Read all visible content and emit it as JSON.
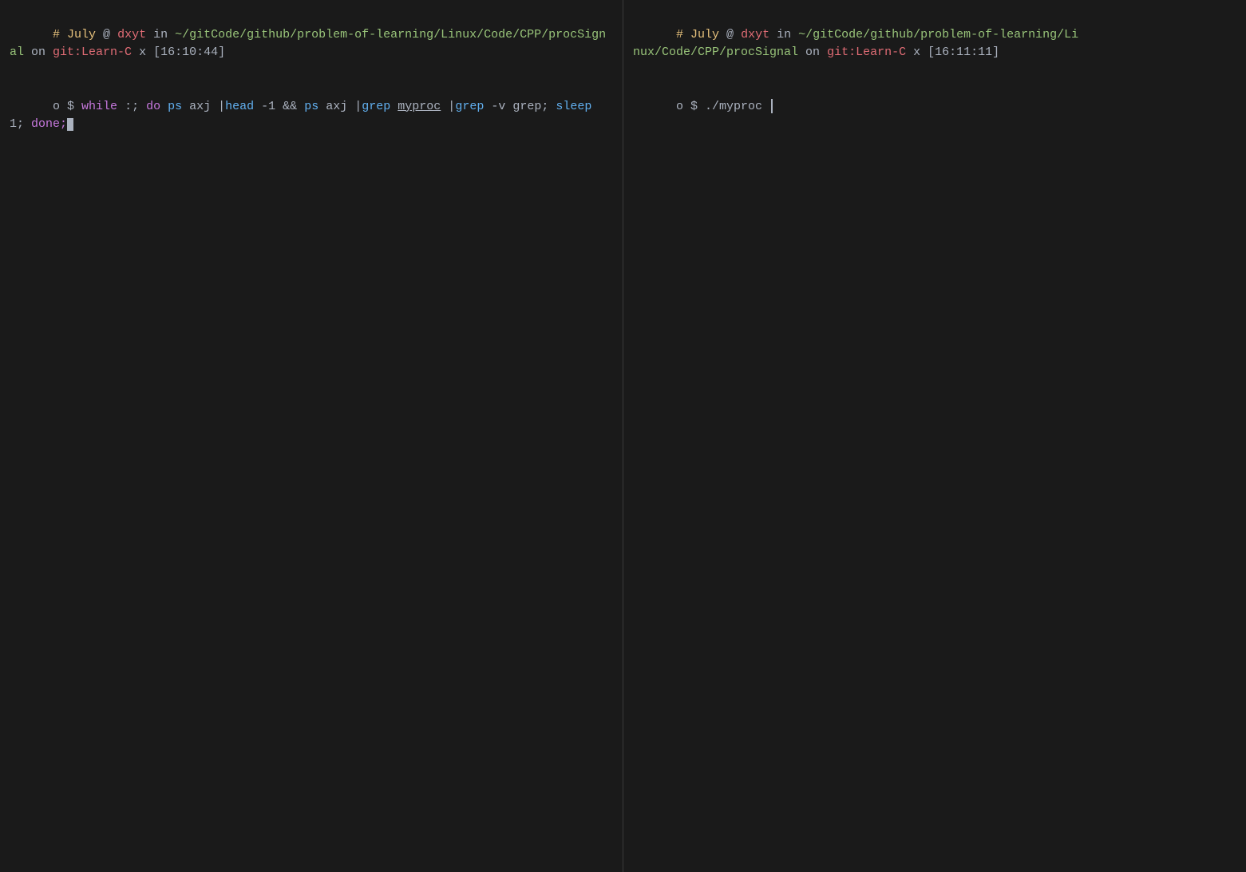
{
  "terminal": {
    "background": "#1a1a1a",
    "left_pane": {
      "prompt1": {
        "hash": "# ",
        "month": "July",
        "at": " @ ",
        "user": "dxyt",
        "in": " in ",
        "path": "~/gitCode/github/problem-of-learning/Linux/Code/CPP/procSignal",
        "on": " on ",
        "git_label": "git:",
        "branch": "Learn-C",
        "x": " x ",
        "time_bracket_open": "[",
        "time": "16:10:44",
        "time_bracket_close": "]"
      },
      "prompt2": {
        "circle": "o",
        "dollar": " $ ",
        "command": "while :; do ps axj |head -1 && ps axj |grep ",
        "myproc": "myproc",
        "pipe_grep": " |grep -v grep; sleep 1; done;"
      }
    },
    "right_pane": {
      "prompt1": {
        "hash": "# ",
        "month": "July",
        "at": " @ ",
        "user": "dxyt",
        "in": " in ",
        "path": "~/gitCode/github/problem-of-learning/Linux/Code/CPP/procSignal",
        "on": " on ",
        "git_label": "git:",
        "branch": "Learn-C",
        "x": " x ",
        "time_bracket_open": "[",
        "time": "16:11:11",
        "time_bracket_close": "]"
      },
      "prompt2": {
        "circle": "o",
        "dollar": " $ ",
        "command": "./myproc "
      }
    }
  }
}
